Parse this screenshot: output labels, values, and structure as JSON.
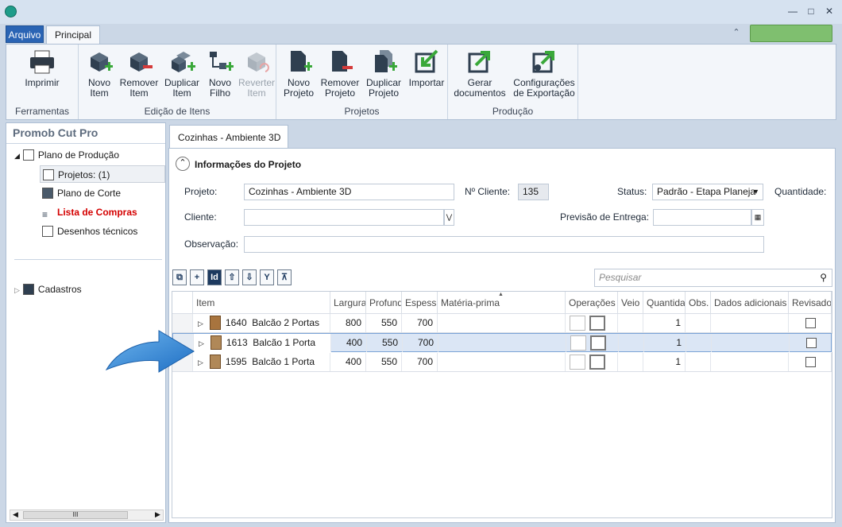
{
  "ribbon": {
    "tabs": [
      "Arquivo",
      "Principal"
    ],
    "groups": [
      {
        "label": "Ferramentas",
        "buttons": [
          {
            "line1": "Imprimir",
            "line2": ""
          }
        ]
      },
      {
        "label": "Edição de Itens",
        "buttons": [
          {
            "line1": "Novo",
            "line2": "Item"
          },
          {
            "line1": "Remover",
            "line2": "Item"
          },
          {
            "line1": "Duplicar",
            "line2": "Item"
          },
          {
            "line1": "Novo",
            "line2": "Filho"
          },
          {
            "line1": "Reverter",
            "line2": "Item"
          }
        ]
      },
      {
        "label": "Projetos",
        "buttons": [
          {
            "line1": "Novo",
            "line2": "Projeto"
          },
          {
            "line1": "Remover",
            "line2": "Projeto"
          },
          {
            "line1": "Duplicar",
            "line2": "Projeto"
          },
          {
            "line1": "Importar",
            "line2": ""
          }
        ]
      },
      {
        "label": "Produção",
        "buttons": [
          {
            "line1": "Gerar",
            "line2": "documentos"
          },
          {
            "line1": "Configurações",
            "line2": "de Exportação"
          }
        ]
      }
    ]
  },
  "left_panel": {
    "title": "Promob Cut Pro",
    "tree": [
      "Plano de Produção",
      "Projetos: (1)",
      "Plano de Corte",
      "Lista de Compras",
      "Desenhos técnicos",
      "Cadastros"
    ],
    "scroll_grip": "III"
  },
  "document_tab": "Cozinhas - Ambiente 3D",
  "project_info": {
    "section_title": "Informações do Projeto",
    "projeto_label": "Projeto:",
    "projeto_value": "Cozinhas - Ambiente 3D",
    "n_cliente_label": "Nº Cliente:",
    "n_cliente_value": "135",
    "status_label": "Status:",
    "status_value": "Padrão - Etapa Planeja",
    "quantidade_label": "Quantidade:",
    "cliente_label": "Cliente:",
    "cliente_value": "",
    "previsao_label": "Previsão de Entrega:",
    "previsao_value": "",
    "observacao_label": "Observação:",
    "observacao_value": ""
  },
  "search": {
    "placeholder": "Pesquisar"
  },
  "grid": {
    "columns": [
      "Item",
      "Largura",
      "Profundi",
      "Espessu",
      "Matéria-prima",
      "Operações",
      "Veio",
      "Quantida",
      "Obs.",
      "Dados adicionais",
      "Revisado"
    ],
    "rows": [
      {
        "code": "1640",
        "name": "Balcão 2 Portas",
        "largura": "800",
        "profundidade": "550",
        "espessura": "700",
        "quantidade": "1"
      },
      {
        "code": "1613",
        "name": "Balcão 1 Porta",
        "largura": "400",
        "profundidade": "550",
        "espessura": "700",
        "quantidade": "1"
      },
      {
        "code": "1595",
        "name": "Balcão 1 Porta",
        "largura": "400",
        "profundidade": "550",
        "espessura": "700",
        "quantidade": "1"
      }
    ],
    "selected_row": 1
  },
  "colors": {
    "accent": "#2a64b4",
    "arrow": "#2a7fd0",
    "red_link": "#d40000"
  }
}
